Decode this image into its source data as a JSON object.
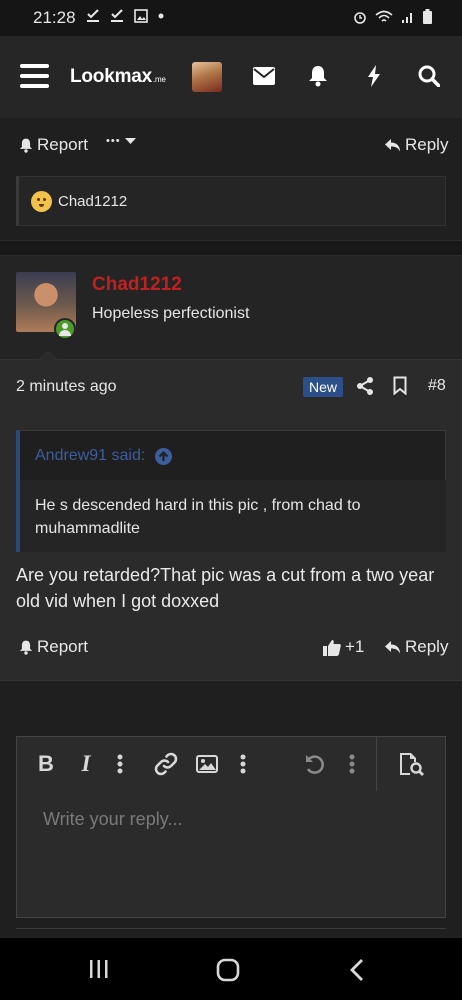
{
  "status_bar": {
    "time": "21:28"
  },
  "header": {
    "logo_text": "Lookmax",
    "logo_suffix": ".me"
  },
  "prev_post": {
    "report_label": "Report",
    "more_label": "•••",
    "reply_label": "Reply",
    "mention_user": "Chad1212"
  },
  "post": {
    "username": "Chad1212",
    "user_title": "Hopeless perfectionist",
    "time": "2 minutes ago",
    "badge": "New",
    "number": "#8",
    "quote_author": "Andrew91 said:",
    "quote_text": "He s descended hard in this pic , from chad to muhammadlite",
    "message": "Are you retarded?That pic was a cut from a two year old vid when I got doxxed",
    "report_label": "Report",
    "like_count": "+1",
    "reply_label": "Reply"
  },
  "editor": {
    "placeholder": "Write your reply..."
  },
  "colors": {
    "username": "#c02020",
    "badge": "#2c4f8a",
    "quote_border": "#2b4a78"
  }
}
